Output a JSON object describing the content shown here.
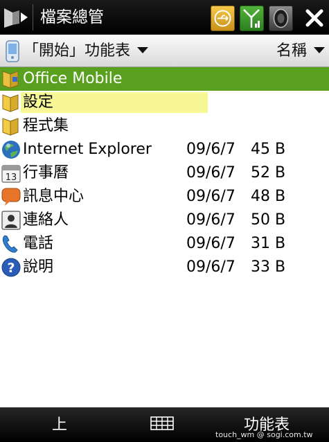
{
  "titlebar": {
    "title": "檔案總管",
    "tray_icons": [
      "usb-icon",
      "signal-icon",
      "volume-icon"
    ],
    "close_icon": "close-icon"
  },
  "toolbar": {
    "folder_path": "「開始」功能表",
    "sort_by": "名稱"
  },
  "files": [
    {
      "name": "Office Mobile",
      "date": "",
      "size": "",
      "icon": "office-folder-icon"
    },
    {
      "name": "設定",
      "date": "",
      "size": "",
      "icon": "folder-icon"
    },
    {
      "name": "程式集",
      "date": "",
      "size": "",
      "icon": "folder-icon"
    },
    {
      "name": "Internet Explorer",
      "date": "09/6/7",
      "size": "45 B",
      "icon": "internet-explorer-icon"
    },
    {
      "name": "行事曆",
      "date": "09/6/7",
      "size": "52 B",
      "icon": "calendar-icon"
    },
    {
      "name": "訊息中心",
      "date": "09/6/7",
      "size": "48 B",
      "icon": "messaging-icon"
    },
    {
      "name": "連絡人",
      "date": "09/6/7",
      "size": "50 B",
      "icon": "contacts-icon"
    },
    {
      "name": "電話",
      "date": "09/6/7",
      "size": "31 B",
      "icon": "phone-icon"
    },
    {
      "name": "說明",
      "date": "09/6/7",
      "size": "33 B",
      "icon": "help-icon"
    }
  ],
  "softkeys": {
    "left": "上",
    "right": "功能表"
  },
  "watermark": "touch_wm    @ sogi.com.tw",
  "colors": {
    "parent_row_bg": "#5aa01f",
    "selection_bg": "#f7f795"
  }
}
